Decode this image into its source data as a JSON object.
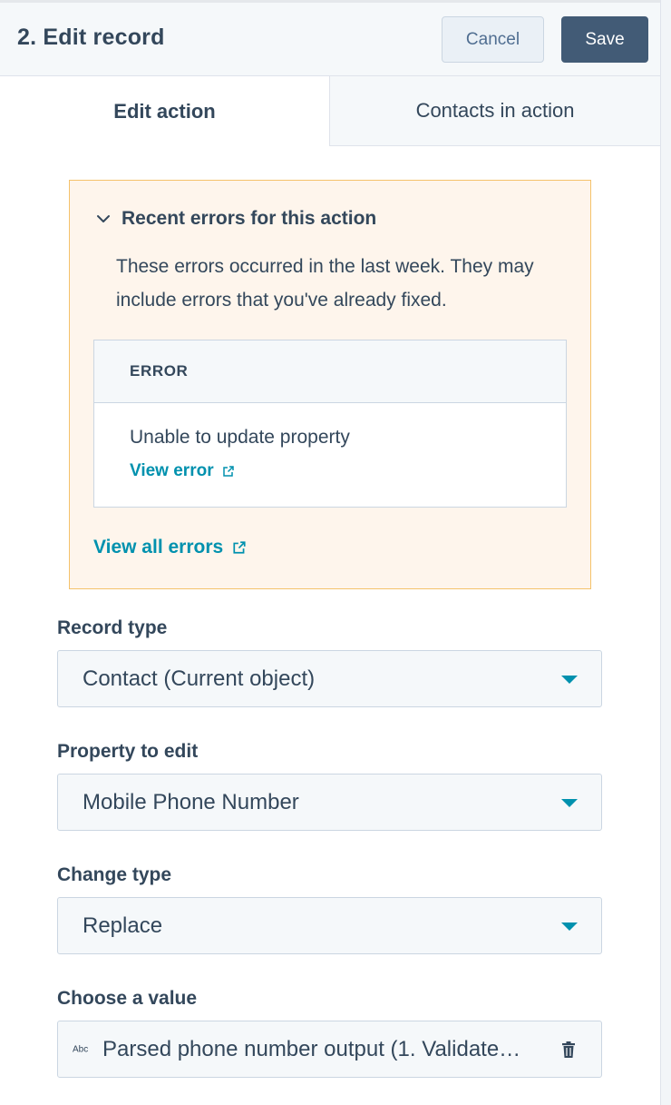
{
  "header": {
    "title": "2. Edit record",
    "cancel_label": "Cancel",
    "save_label": "Save"
  },
  "tabs": [
    {
      "label": "Edit action",
      "active": true
    },
    {
      "label": "Contacts in action",
      "active": false
    }
  ],
  "errors_panel": {
    "title": "Recent errors for this action",
    "description": "These errors occurred in the last week. They may include errors that you've already fixed.",
    "table_header": "ERROR",
    "rows": [
      {
        "message": "Unable to update property",
        "link_label": "View error"
      }
    ],
    "view_all_label": "View all errors"
  },
  "fields": {
    "record_type": {
      "label": "Record type",
      "value": "Contact (Current object)"
    },
    "property_to_edit": {
      "label": "Property to edit",
      "value": "Mobile Phone Number"
    },
    "change_type": {
      "label": "Change type",
      "value": "Replace"
    },
    "choose_value": {
      "label": "Choose a value",
      "type_badge": "Abc",
      "value": "Parsed phone number output (1. Validate…"
    }
  },
  "colors": {
    "accent_link": "#0091ae",
    "primary_button": "#425b76",
    "alert_bg": "#fef5ec",
    "alert_border": "#f5c26b",
    "text": "#33475b"
  },
  "icons": {
    "collapse": "chevron-down-icon",
    "external": "external-link-icon",
    "dropdown": "caret-down-icon",
    "delete": "trash-icon"
  }
}
